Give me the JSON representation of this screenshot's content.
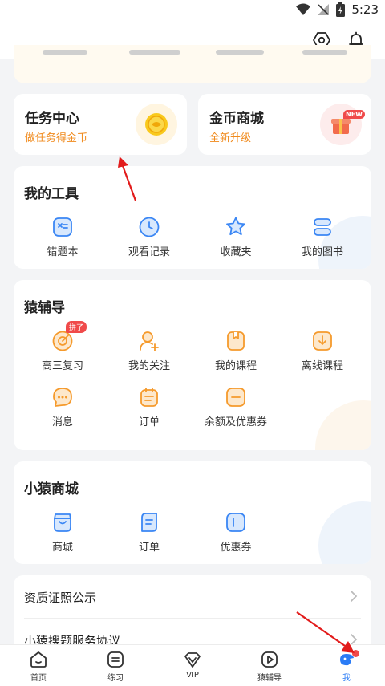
{
  "status": {
    "time": "5:23"
  },
  "promo": [
    {
      "title": "任务中心",
      "subtitle": "做任务得金币"
    },
    {
      "title": "金币商城",
      "subtitle": "全新升级",
      "badge": "NEW"
    }
  ],
  "tools": {
    "title": "我的工具",
    "items": [
      {
        "label": "错题本",
        "icon": "wrong-book-icon"
      },
      {
        "label": "观看记录",
        "icon": "clock-icon"
      },
      {
        "label": "收藏夹",
        "icon": "star-icon"
      },
      {
        "label": "我的图书",
        "icon": "books-icon"
      }
    ]
  },
  "tutoring": {
    "title": "猿辅导",
    "items": [
      {
        "label": "高三复习",
        "icon": "target-icon",
        "badge": "拼了"
      },
      {
        "label": "我的关注",
        "icon": "follow-user-icon"
      },
      {
        "label": "我的课程",
        "icon": "course-icon"
      },
      {
        "label": "离线课程",
        "icon": "download-icon"
      },
      {
        "label": "消息",
        "icon": "chat-icon"
      },
      {
        "label": "订单",
        "icon": "order-icon"
      },
      {
        "label": "余额及优惠券",
        "icon": "wallet-icon"
      }
    ]
  },
  "mall": {
    "title": "小猿商城",
    "items": [
      {
        "label": "商城",
        "icon": "shop-bag-icon"
      },
      {
        "label": "订单",
        "icon": "order-doc-icon"
      },
      {
        "label": "优惠券",
        "icon": "coupon-icon"
      }
    ]
  },
  "links": [
    {
      "label": "资质证照公示"
    },
    {
      "label": "小猿搜题服务协议"
    }
  ],
  "nav": [
    {
      "label": "首页",
      "icon": "home-icon"
    },
    {
      "label": "练习",
      "icon": "practice-icon"
    },
    {
      "label": "VIP",
      "icon": "vip-icon"
    },
    {
      "label": "猿辅导",
      "icon": "play-icon"
    },
    {
      "label": "我",
      "icon": "me-icon",
      "active": true
    }
  ],
  "colors": {
    "accent": "#2b7cf6",
    "orange": "#f08a1c",
    "red": "#f04a4a",
    "icon_orange": "#f59a2c",
    "icon_blue": "#3a86f4"
  }
}
